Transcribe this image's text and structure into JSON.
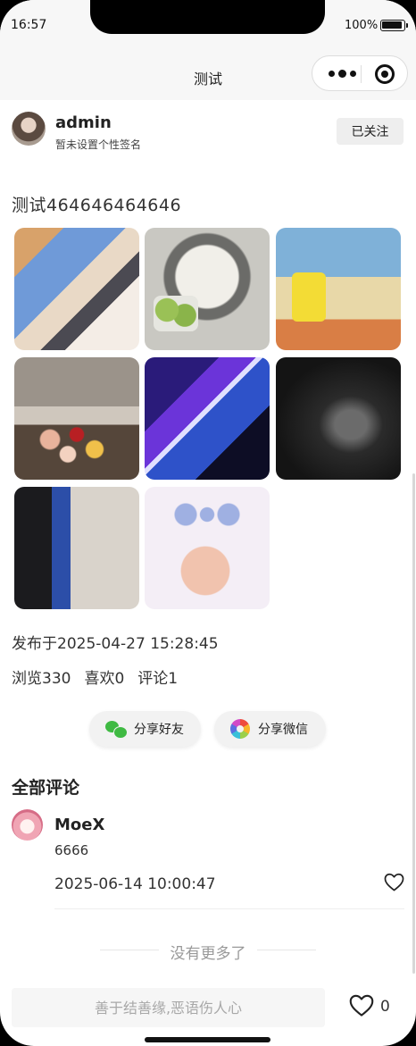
{
  "status_bar": {
    "time": "16:57",
    "battery": "100%"
  },
  "nav": {
    "title": "测试"
  },
  "author": {
    "name": "admin",
    "signature": "暂未设置个性签名",
    "follow_label": "已关注"
  },
  "post": {
    "title": "测试464646464646",
    "published": "发布于2025-04-27 15:28:45",
    "stats": {
      "views": "浏览330",
      "likes": "喜欢0",
      "comments": "评论1"
    }
  },
  "share": {
    "friend_label": "分享好友",
    "wechat_label": "分享微信"
  },
  "comments": {
    "title": "全部评论",
    "items": [
      {
        "name": "MoeX",
        "text": "6666",
        "time": "2025-06-14 10:00:47"
      }
    ],
    "no_more": "没有更多了"
  },
  "footer": {
    "input_placeholder": "善于结善缘,恶语伤人心",
    "like_count": "0"
  },
  "icons": {
    "capsule_menu": "more-dots-icon",
    "capsule_close": "target-icon",
    "share_friend": "wechat-icon",
    "share_wechat": "moments-icon",
    "like": "heart-icon"
  }
}
